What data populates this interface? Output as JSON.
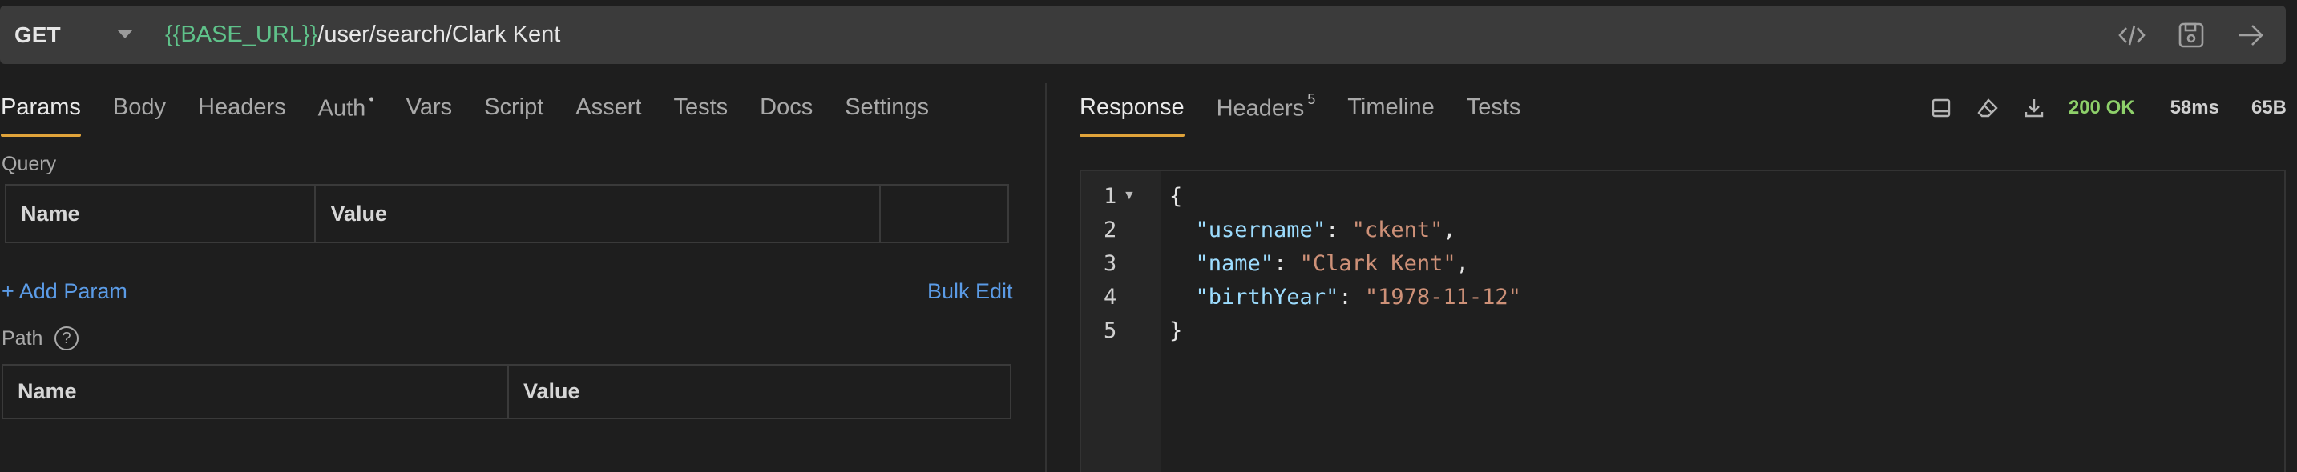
{
  "request": {
    "method": "GET",
    "url_variable": "{{BASE_URL}}",
    "url_path": "/user/search/Clark Kent",
    "actions": [
      "code-icon",
      "save-icon",
      "send-arrow-icon"
    ]
  },
  "request_tabs": [
    {
      "label": "Params",
      "active": true
    },
    {
      "label": "Body"
    },
    {
      "label": "Headers"
    },
    {
      "label": "Auth",
      "indicator": "•"
    },
    {
      "label": "Vars"
    },
    {
      "label": "Script"
    },
    {
      "label": "Assert"
    },
    {
      "label": "Tests"
    },
    {
      "label": "Docs"
    },
    {
      "label": "Settings"
    }
  ],
  "params": {
    "query_label": "Query",
    "query_headers": [
      "Name",
      "Value",
      ""
    ],
    "add_param": "+ Add Param",
    "bulk_edit": "Bulk Edit",
    "path_label": "Path",
    "path_help": "?",
    "path_headers": [
      "Name",
      "Value"
    ]
  },
  "response_tabs": [
    {
      "label": "Response",
      "active": true
    },
    {
      "label": "Headers",
      "count": "5"
    },
    {
      "label": "Timeline"
    },
    {
      "label": "Tests"
    }
  ],
  "response_status": {
    "code": "200 OK",
    "time": "58ms",
    "size": "65B",
    "code_color": "#8ed06a",
    "icons": [
      "layout-icon",
      "eraser-icon",
      "download-icon"
    ]
  },
  "response_body": {
    "line_numbers": [
      "1",
      "2",
      "3",
      "4",
      "5"
    ],
    "lines": [
      {
        "open": "{"
      },
      {
        "key": "\"username\"",
        "value": "\"ckent\"",
        "trail": ","
      },
      {
        "key": "\"name\"",
        "value": "\"Clark Kent\"",
        "trail": ","
      },
      {
        "key": "\"birthYear\"",
        "value": "\"1978-11-12\"",
        "trail": ""
      },
      {
        "close": "}"
      }
    ]
  },
  "colors": {
    "accent": "#e0a33a",
    "link": "#5b9be6",
    "url_variable": "#5fc28a"
  }
}
